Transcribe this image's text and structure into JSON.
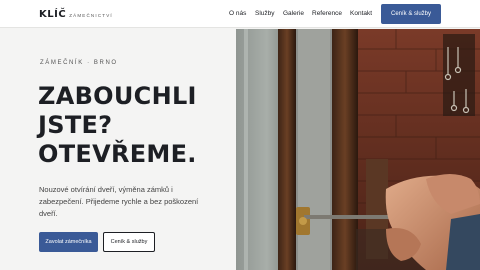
{
  "header": {
    "logo": "KLÍČ",
    "logo_sub": "ZÁMEČNICTVÍ",
    "nav": [
      "O nás",
      "Služby",
      "Galerie",
      "Reference",
      "Kontakt"
    ],
    "cta": "Ceník & služby"
  },
  "hero": {
    "eyebrow": "ZÁMEČNÍK · BRNO",
    "headline": [
      "ZABOUCHLI",
      "JSTE?",
      "OTEVŘEME."
    ],
    "description": "Nouzové otvírání dveří, výměna zámků i zabezpečení. Přijedeme rychle a bez poškození dveří.",
    "primary_button": "Zavolat zámečníka",
    "secondary_button": "Ceník & služby"
  },
  "colors": {
    "accent": "#3a5a97",
    "background": "#f4f4f3",
    "text": "#1d1f24"
  },
  "photo": {
    "subject": "locksmith-hands-with-tool-at-door-lock"
  }
}
